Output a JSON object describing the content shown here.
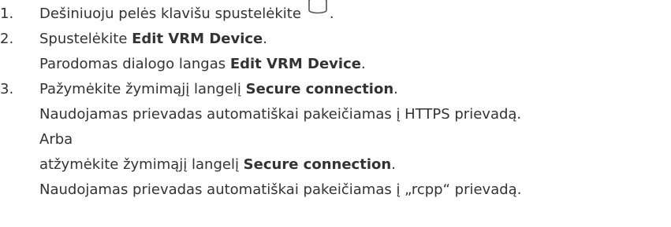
{
  "steps": [
    {
      "number": "1.",
      "text": "Dešiniuoju pelės klavišu spustelėkite",
      "icon": "storage-device-icon",
      "trailing": "."
    },
    {
      "number": "2.",
      "text_pre": "Spustelėkite ",
      "bold": "Edit VRM Device",
      "text_post": ".",
      "result_pre": "Parodomas dialogo langas ",
      "result_bold": "Edit VRM Device",
      "result_post": "."
    },
    {
      "number": "3.",
      "text_pre": "Pažymėkite žymimąjį langelį ",
      "bold": "Secure connection",
      "text_post": ".",
      "result": "Naudojamas prievadas automatiškai pakeičiamas į HTTPS prievadą.",
      "alt_label": "Arba",
      "alt_pre": "atžymėkite žymimąjį langelį ",
      "alt_bold": "Secure connection",
      "alt_post": ".",
      "alt_result": "Naudojamas prievadas automatiškai pakeičiamas į „rcpp“ prievadą."
    }
  ]
}
